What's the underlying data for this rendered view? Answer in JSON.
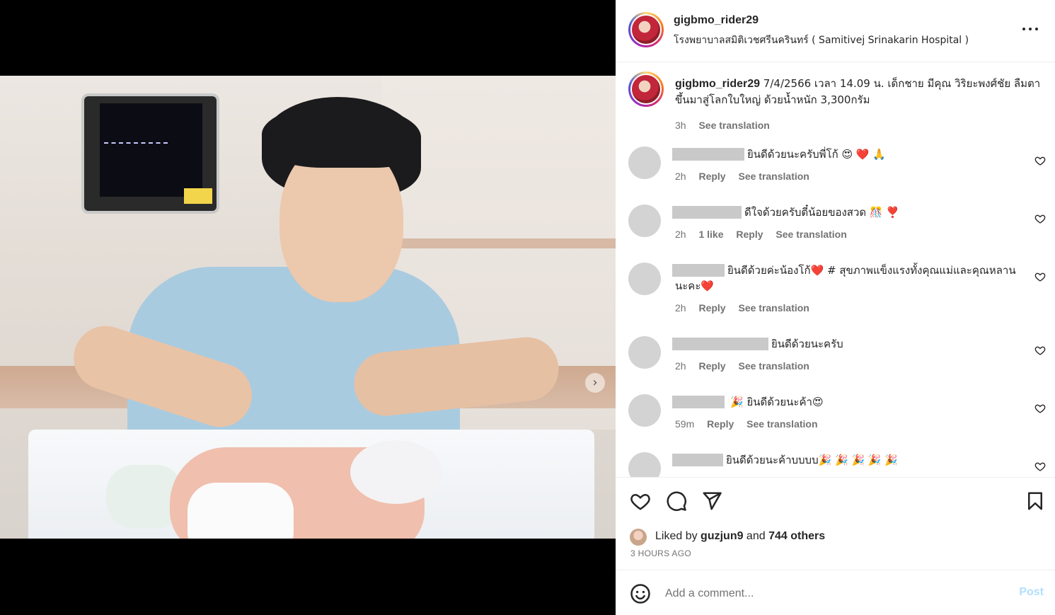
{
  "post": {
    "username": "gigbmo_rider29",
    "location": "โรงพยาบาลสมิติเวชศรีนครินทร์ ( Samitivej Srinakarin Hospital )"
  },
  "caption": {
    "username": "gigbmo_rider29",
    "text": " 7/4/2566 เวลา 14.09 น. เด็กชาย มีคุณ วิริยะพงศ์ชัย ลืมตาขึ้นมาสู่โลกใบใหญ่ ด้วยน้ำหนัก 3,300กรัม",
    "time": "3h",
    "see_translation": "See translation"
  },
  "comments": [
    {
      "text": "ยินดีด้วยนะครับพี่โก้ 😍 ❤️ 🙏",
      "time": "2h",
      "likes": "",
      "reply": "Reply",
      "see_translation": "See translation"
    },
    {
      "text": "ดีใจด้วยครับตี๋น้อยของสวด 🎊 ❣️",
      "time": "2h",
      "likes": "1 like",
      "reply": "Reply",
      "see_translation": "See translation"
    },
    {
      "text": "ยินดีด้วยค่ะน้องโก้❤️ # สุขภาพแข็งแรงทั้งคุณแม่และคุณหลานนะคะ❤️",
      "time": "2h",
      "likes": "",
      "reply": "Reply",
      "see_translation": "See translation"
    },
    {
      "text": "ยินดีด้วยนะครับ",
      "time": "2h",
      "likes": "",
      "reply": "Reply",
      "see_translation": "See translation"
    },
    {
      "text": "🎉 ยินดีด้วยนะค้า😍",
      "time": "59m",
      "likes": "",
      "reply": "Reply",
      "see_translation": "See translation"
    },
    {
      "text": "ยินดีด้วยนะค้าบบบบ🎉 🎉 🎉 🎉 🎉",
      "time": "",
      "likes": "",
      "reply": "",
      "see_translation": ""
    }
  ],
  "likes": {
    "prefix": "Liked by ",
    "user": "guzjun9",
    "middle": " and ",
    "others": "744 others"
  },
  "time_ago": "3 HOURS AGO",
  "add_comment": {
    "placeholder": "Add a comment...",
    "post_label": "Post"
  },
  "icons": [
    "more-icon",
    "heart-icon",
    "comment-icon",
    "share-icon",
    "bookmark-icon",
    "emoji-icon",
    "chevron-right-icon"
  ],
  "colors": {
    "link": "#0095f6",
    "muted": "#737373",
    "post_disabled": "#b2dffc"
  }
}
